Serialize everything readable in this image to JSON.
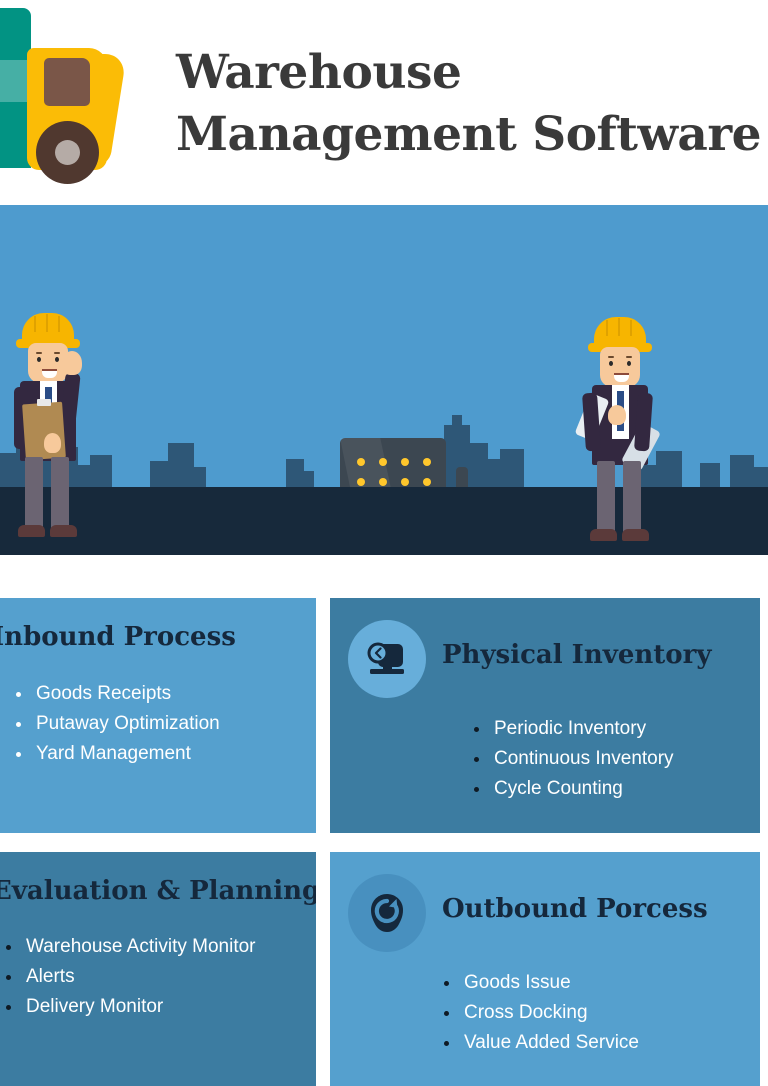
{
  "header": {
    "title_line1": "Warehouse",
    "title_line2": "Management Software",
    "logo_icon": "delivery-truck-icon",
    "title_color": "#3a3a3a",
    "truck_colors": {
      "trailer": "#029383",
      "trailer_stripe": "#46AFA5",
      "cab": "#FBBC06",
      "window": "#7A5648",
      "wheel": "#50382F",
      "hub": "#B5ABA6"
    }
  },
  "hero": {
    "alt": "warehouse-city-illustration",
    "sky_color": "#4E9BCE",
    "ground_color": "#17293B",
    "skyline_color": "#2E5777",
    "building_color": "#3C4751",
    "window_color": "#FFC72C",
    "workers": [
      {
        "name": "waving-worker-with-clipboard",
        "hat_color": "#F7B500",
        "suit_color": "#332840"
      },
      {
        "name": "worker-with-blueprints",
        "hat_color": "#F7B500",
        "suit_color": "#332840"
      }
    ]
  },
  "cards": [
    {
      "id": "inbound-process",
      "title": "Inbound Process",
      "icon": null,
      "background": "#55A0CE",
      "bullet_color": "#FFFFFF",
      "items": [
        "Goods Receipts",
        "Putaway Optimization",
        "Yard Management"
      ]
    },
    {
      "id": "physical-inventory",
      "title": "Physical Inventory",
      "icon": "inventory-clock-icon",
      "background": "#3C7CA1",
      "bullet_color": "#0F1A24",
      "items": [
        "Periodic Inventory",
        "Continuous Inventory",
        "Cycle Counting"
      ]
    },
    {
      "id": "evaluation-and-planning",
      "title": "Evaluation & Planning",
      "icon": null,
      "background": "#3C7CA1",
      "bullet_color": "#0F1A24",
      "items": [
        "Warehouse Activity Monitor",
        "Alerts",
        "Delivery Monitor"
      ]
    },
    {
      "id": "outbound-porcess",
      "title": "Outbound Porcess",
      "icon": "refresh-cycle-icon",
      "background": "#55A0CE",
      "bullet_color": "#0F1A24",
      "items": [
        "Goods Issue",
        "Cross Docking",
        "Value Added Service"
      ]
    }
  ]
}
